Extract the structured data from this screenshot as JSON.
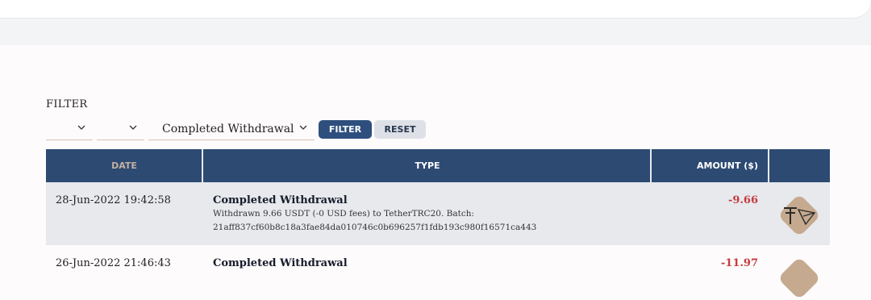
{
  "filter": {
    "title": "FILTER",
    "select1_value": "",
    "select2_value": "",
    "type_select_value": "Completed Withdrawal",
    "filter_button": "FILTER",
    "reset_button": "RESET"
  },
  "table": {
    "headers": {
      "date": "DATE",
      "type": "TYPE",
      "amount": "AMOUNT ($)"
    },
    "rows": [
      {
        "date": "28-Jun-2022 19:42:58",
        "type_title": "Completed Withdrawal",
        "description_line1": "Withdrawn 9.66 USDT (-0 USD fees) to TetherTRC20. Batch:",
        "description_line2": "21aff837cf60b8c18a3fae84da010746c0b696257f1fdb193c980f16571ca443",
        "amount": "-9.66",
        "icon": "tether-trc20-icon"
      },
      {
        "date": "26-Jun-2022 21:46:43",
        "type_title": "Completed Withdrawal",
        "amount": "-11.97",
        "icon": "tether-trc20-icon"
      }
    ]
  },
  "colors": {
    "header_bg": "#2d4a73",
    "filter_button_bg": "#2e4f7e",
    "negative_amount": "#c53b3f",
    "coin_bg": "#c6aa8f"
  }
}
